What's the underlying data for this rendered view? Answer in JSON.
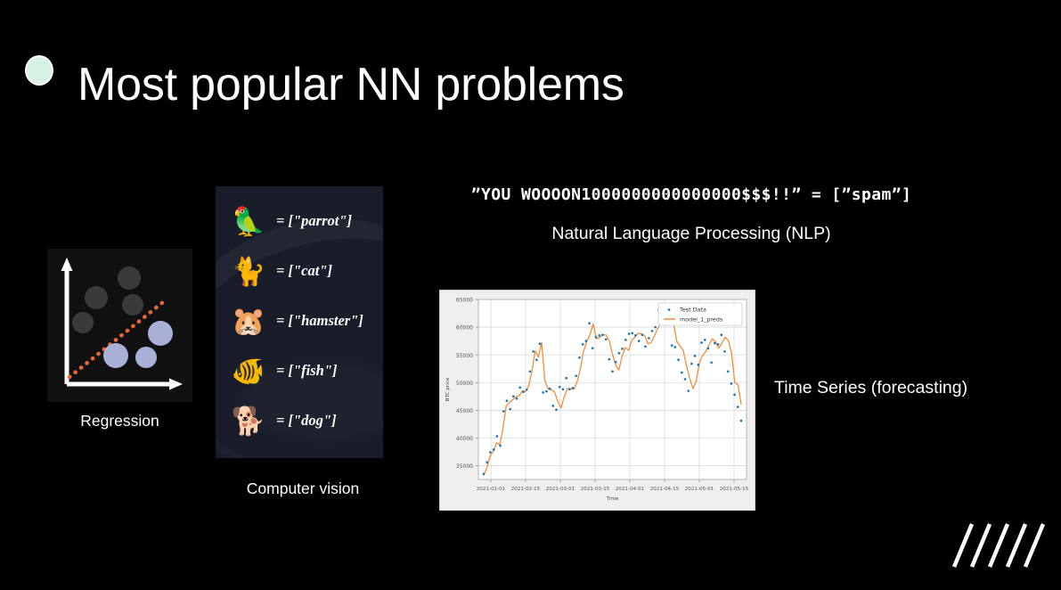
{
  "slide": {
    "title": "Most popular NN problems",
    "background_color": "#000000",
    "bullet_color": "#d7f2e3"
  },
  "regression": {
    "caption": "Regression",
    "axis_color": "#ffffff",
    "trend_line_color": "#e8683a",
    "upper_point_color": "#3a3a3a",
    "lower_point_color": "#a8b0d8",
    "upper_points": [
      {
        "x": 0.56,
        "y": 0.12
      },
      {
        "x": 0.32,
        "y": 0.3
      },
      {
        "x": 0.63,
        "y": 0.35
      },
      {
        "x": 0.17,
        "y": 0.5
      }
    ],
    "lower_points": [
      {
        "x": 0.84,
        "y": 0.59
      },
      {
        "x": 0.42,
        "y": 0.76
      },
      {
        "x": 0.7,
        "y": 0.79
      }
    ]
  },
  "computer_vision": {
    "caption": "Computer vision",
    "panel_color": "#191d29",
    "rows": [
      {
        "emoji": "🦜",
        "icon_name": "parrot-emoji",
        "label": "= [\"parrot\"]"
      },
      {
        "emoji": "🐈",
        "icon_name": "cat-emoji",
        "label": "= [\"cat\"]"
      },
      {
        "emoji": "🐹",
        "icon_name": "hamster-emoji",
        "label": "= [\"hamster\"]"
      },
      {
        "emoji": "🐠",
        "icon_name": "fish-emoji",
        "label": "= [\"fish\"]"
      },
      {
        "emoji": "🐕",
        "icon_name": "dog-emoji",
        "label": "= [\"dog\"]"
      }
    ]
  },
  "nlp": {
    "code_example": "”YOU WOOOON1000000000000000$$$!!” = [”spam”]",
    "caption": "Natural Language Processing (NLP)"
  },
  "time_series": {
    "caption": "Time Series (forecasting)"
  },
  "chart_data": {
    "type": "line",
    "title": "",
    "xlabel": "Time",
    "ylabel": "BTC price",
    "grid": true,
    "legend_position": "upper right",
    "xlim": [
      "2021-01-29",
      "2021-05-18"
    ],
    "ylim": [
      32500,
      65000
    ],
    "ytick_labels": [
      "35000",
      "40000",
      "45000",
      "50000",
      "55000",
      "60000",
      "65000"
    ],
    "yticks": [
      35000,
      40000,
      45000,
      50000,
      55000,
      60000,
      65000
    ],
    "xtick_labels": [
      "2021-02-01",
      "2021-02-15",
      "2021-03-01",
      "2021-03-15",
      "2021-04-01",
      "2021-04-15",
      "2021-05-01",
      "2021-05-15"
    ],
    "series": [
      {
        "name": "Test Data",
        "type": "scatter",
        "color": "#1f77b4",
        "values": [
          33500,
          35600,
          37400,
          37900,
          40300,
          38600,
          44800,
          46700,
          45200,
          47500,
          47100,
          49100,
          48300,
          48700,
          52000,
          55600,
          54100,
          57000,
          48200,
          48400,
          48900,
          45800,
          45100,
          49200,
          48800,
          50800,
          48800,
          49000,
          51200,
          54500,
          56900,
          57500,
          60700,
          56200,
          58200,
          58500,
          58600,
          57800,
          54200,
          52000,
          53700,
          55300,
          56100,
          57700,
          58800,
          58900,
          58500,
          57500,
          58600,
          56500,
          58000,
          59300,
          60000,
          63200,
          63400,
          61800,
          60500,
          56700,
          56400,
          54100,
          51800,
          50600,
          48500,
          53400,
          54800,
          53200,
          57200,
          57700,
          56200,
          53600,
          57100,
          56900,
          58600,
          55600,
          52000,
          49800,
          47800,
          45600,
          43100
        ]
      },
      {
        "name": "model_1_preds",
        "type": "line",
        "color": "#ef8e3b",
        "values": [
          33300,
          34600,
          36800,
          37600,
          39100,
          38800,
          41800,
          45800,
          46400,
          46900,
          47400,
          47600,
          48500,
          48400,
          49400,
          52200,
          55700,
          54600,
          57200,
          50400,
          48800,
          48700,
          48300,
          46600,
          45400,
          47400,
          48900,
          48900,
          48800,
          50100,
          52400,
          55600,
          57400,
          58600,
          60600,
          57900,
          58100,
          58600,
          58600,
          57500,
          55200,
          53100,
          52300,
          54800,
          56300,
          55800,
          57600,
          58200,
          58900,
          58800,
          58500,
          57000,
          57200,
          58400,
          59700,
          60600,
          62100,
          63600,
          62600,
          60700,
          57400,
          56600,
          55800,
          53000,
          50800,
          48900,
          50200,
          53500,
          54900,
          55600,
          56800,
          57900,
          57400,
          56200,
          57100,
          58200,
          57600,
          55400,
          50000,
          49600,
          46100
        ]
      }
    ]
  }
}
